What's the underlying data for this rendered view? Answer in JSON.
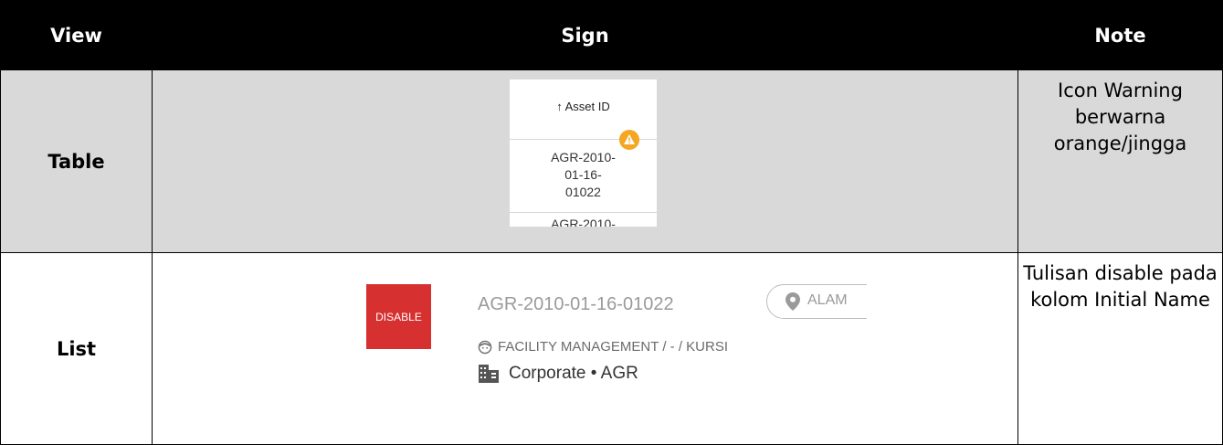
{
  "headers": {
    "view": "View",
    "sign": "Sign",
    "note": "Note"
  },
  "rows": [
    {
      "view": "Table",
      "note": "Icon Warning berwarna orange/jingga",
      "sample": {
        "column_header": "↑ Asset ID",
        "cell_lines": [
          "AGR-2010-",
          "01-16-",
          "01022"
        ],
        "next_row_partial": "AGR-2010-",
        "warning_icon": "warning-icon",
        "warning_color": "#f5a623"
      }
    },
    {
      "view": "List",
      "note": "Tulisan disable pada kolom Initial Name",
      "sample": {
        "badge": "DISABLE",
        "badge_color": "#d63030",
        "asset_id": "AGR-2010-01-16-01022",
        "location": "ALAM",
        "category": "FACILITY MANAGEMENT / - / KURSI",
        "org": "Corporate • AGR"
      }
    }
  ]
}
